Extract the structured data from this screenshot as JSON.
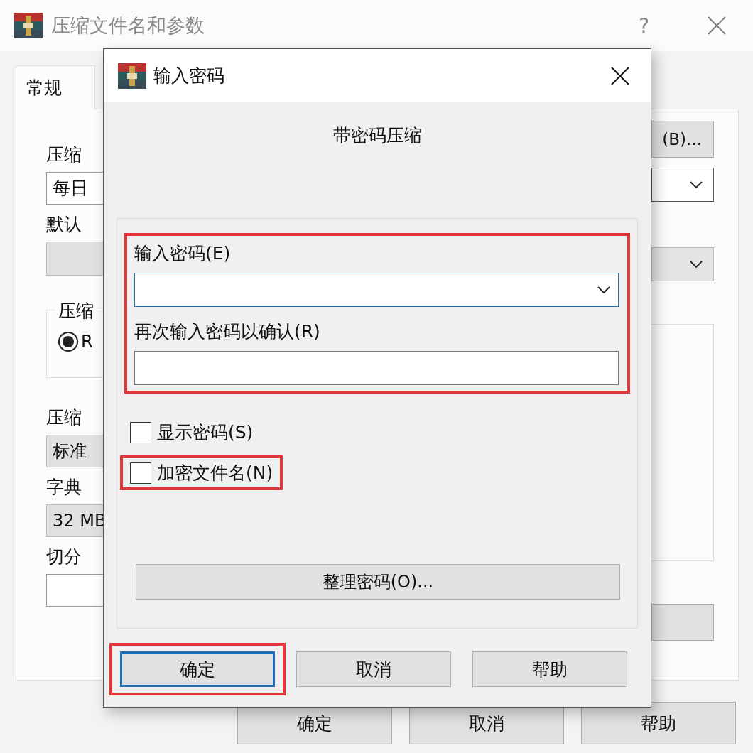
{
  "window": {
    "title": "压缩文件名和参数",
    "help_button": "?"
  },
  "tabs": [
    {
      "label": "常规",
      "selected": true
    }
  ],
  "left_items": [
    {
      "kind": "label",
      "text": "压缩"
    },
    {
      "kind": "field",
      "text": "每日"
    },
    {
      "kind": "label",
      "text": "默认"
    },
    {
      "kind": "blank_button"
    },
    {
      "kind": "group",
      "text": "压缩",
      "option": {
        "label": "R",
        "selected": true
      }
    },
    {
      "kind": "label",
      "text": "压缩"
    },
    {
      "kind": "select",
      "text": "标准"
    },
    {
      "kind": "label",
      "text": "字典"
    },
    {
      "kind": "select",
      "text": "32 MB"
    },
    {
      "kind": "label",
      "text": "切分"
    },
    {
      "kind": "field"
    }
  ],
  "right_items": [
    {
      "kind": "button",
      "text": "(B)..."
    },
    {
      "kind": "combo"
    },
    {
      "kind": "select"
    },
    {
      "kind": "group"
    },
    {
      "kind": "blank_button"
    }
  ],
  "bottom_buttons": [
    "确定",
    "取消",
    "帮助"
  ],
  "dialog": {
    "title": "输入密码",
    "heading": "带密码压缩",
    "password_group": {
      "highlighted": true,
      "fields": [
        {
          "label": "输入密码(E)",
          "kind": "combo",
          "focused": true
        },
        {
          "label": "再次输入密码以确认(R)",
          "kind": "text",
          "focused": false
        }
      ]
    },
    "options": [
      {
        "label": "显示密码(S)",
        "checked": false,
        "highlighted": false
      },
      {
        "label": "加密文件名(N)",
        "checked": false,
        "highlighted": true
      }
    ],
    "organize_button": "整理密码(O)...",
    "buttons": [
      {
        "label": "确定",
        "default": true,
        "highlighted": true
      },
      {
        "label": "取消",
        "default": false,
        "highlighted": false
      },
      {
        "label": "帮助",
        "default": false,
        "highlighted": false
      }
    ]
  }
}
